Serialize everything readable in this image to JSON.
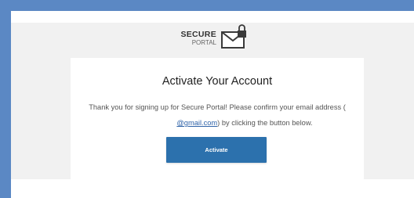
{
  "logo": {
    "line1": "SECURE",
    "line2": "PORTAL",
    "icon": "envelope-lock-icon"
  },
  "card": {
    "title": "Activate Your Account",
    "body_before": "Thank you for signing up for Secure Portal! Please confirm your email address (",
    "email_link": "@gmail.com",
    "body_after": ") by clicking the button below."
  },
  "button": {
    "label": "Activate"
  },
  "colors": {
    "frame": "#5b88c4",
    "button": "#2c71ad",
    "link": "#2f63a8",
    "background": "#f1f1f1"
  }
}
